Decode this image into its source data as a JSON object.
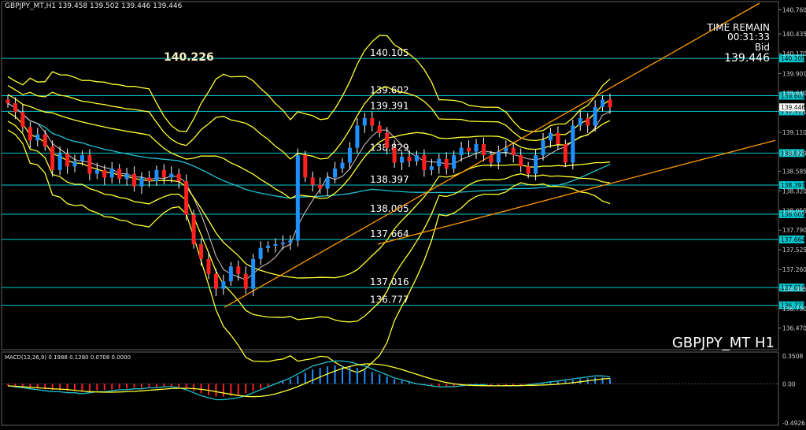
{
  "header": {
    "symbol_line": "GBPJPY_MT,H1  139.458 139.502 139.446 139.446",
    "big_price": "140.226"
  },
  "time_remain": {
    "title": "TIME REMAIN",
    "value": "00:31:33",
    "bid_label": "Bid",
    "bid_value": "139.446"
  },
  "symbol_tf": "GBPJPY_MT  H1",
  "colors": {
    "background": "#000000",
    "bull": "#1e90ff",
    "bear": "#ff2020",
    "bands": "#ffff33",
    "level": "#00c8d0",
    "trend": "#ff9900",
    "ma_cyan": "#20c0d0",
    "macd_up": "#1e90ff",
    "macd_down": "#ff2020"
  },
  "chart_data": [
    {
      "type": "candlestick",
      "ylim": [
        136.2,
        140.85
      ],
      "y_ticks": [
        "140.760",
        "140.435",
        "140.170",
        "139.901",
        "139.640",
        "139.391",
        "139.110",
        "138.829",
        "138.585",
        "138.320",
        "138.055",
        "137.790",
        "137.525",
        "137.260",
        "136.995",
        "136.730",
        "136.470"
      ],
      "levels": [
        {
          "value": 140.105,
          "label": "140.105",
          "axis": "140.105"
        },
        {
          "value": 139.602,
          "label": "139.602",
          "axis": "139.602"
        },
        {
          "value": 139.391,
          "label": "139.391",
          "axis": "139.391"
        },
        {
          "value": 138.829,
          "label": "138.829",
          "axis": "138.829"
        },
        {
          "value": 138.397,
          "label": "138.397",
          "axis": "138.397"
        },
        {
          "value": 138.005,
          "label": "138.005",
          "axis": "138.005"
        },
        {
          "value": 137.664,
          "label": "137.664",
          "axis": "137.664"
        },
        {
          "value": 137.016,
          "label": "137.016",
          "axis": "137.016"
        },
        {
          "value": 136.777,
          "label": "136.777",
          "axis": "136.777"
        }
      ],
      "current_price": {
        "value": 139.446,
        "label": "139.446"
      },
      "closes": [
        139.5,
        139.38,
        139.18,
        139.0,
        139.08,
        138.92,
        138.6,
        138.82,
        138.65,
        138.72,
        138.8,
        138.55,
        138.6,
        138.5,
        138.62,
        138.48,
        138.55,
        138.38,
        138.5,
        138.45,
        138.6,
        138.5,
        138.55,
        138.45,
        138.0,
        137.6,
        137.4,
        137.2,
        137.0,
        137.1,
        137.3,
        137.2,
        137.0,
        137.4,
        137.55,
        137.58,
        137.6,
        137.62,
        137.65,
        138.8,
        138.5,
        138.4,
        138.35,
        138.5,
        138.62,
        138.7,
        138.9,
        139.2,
        139.3,
        139.2,
        139.1,
        138.9,
        138.7,
        138.78,
        138.72,
        138.8,
        138.6,
        138.65,
        138.75,
        138.62,
        138.8,
        138.9,
        138.85,
        138.95,
        138.8,
        138.7,
        138.85,
        138.9,
        138.8,
        138.65,
        138.55,
        138.8,
        139.0,
        139.1,
        138.95,
        138.7,
        139.2,
        139.3,
        139.2,
        139.45,
        139.55,
        139.446
      ]
    },
    {
      "type": "bar",
      "title": "MACD(12,26,9) 0.1988 0.1280 0.0708 0.0000",
      "ylim": [
        -0.4926,
        0.3508
      ],
      "y_ticks": [
        "0.3508",
        "0.00",
        "-0.4926"
      ],
      "values": [
        -0.02,
        -0.03,
        -0.04,
        -0.05,
        -0.06,
        -0.07,
        -0.08,
        -0.08,
        -0.09,
        -0.09,
        -0.1,
        -0.09,
        -0.08,
        -0.08,
        -0.07,
        -0.06,
        -0.06,
        -0.05,
        -0.05,
        -0.04,
        -0.04,
        -0.03,
        -0.03,
        -0.04,
        -0.06,
        -0.09,
        -0.12,
        -0.14,
        -0.16,
        -0.16,
        -0.15,
        -0.14,
        -0.12,
        -0.09,
        -0.06,
        -0.03,
        0.0,
        0.03,
        0.06,
        0.1,
        0.14,
        0.18,
        0.2,
        0.22,
        0.23,
        0.23,
        0.22,
        0.2,
        0.18,
        0.15,
        0.12,
        0.09,
        0.06,
        0.04,
        0.02,
        0.0,
        -0.01,
        -0.02,
        -0.03,
        -0.03,
        -0.03,
        -0.02,
        -0.01,
        -0.01,
        -0.01,
        -0.02,
        -0.02,
        -0.02,
        -0.02,
        -0.02,
        -0.01,
        0.0,
        0.01,
        0.02,
        0.03,
        0.04,
        0.05,
        0.06,
        0.07,
        0.08,
        0.08,
        0.07
      ]
    }
  ]
}
